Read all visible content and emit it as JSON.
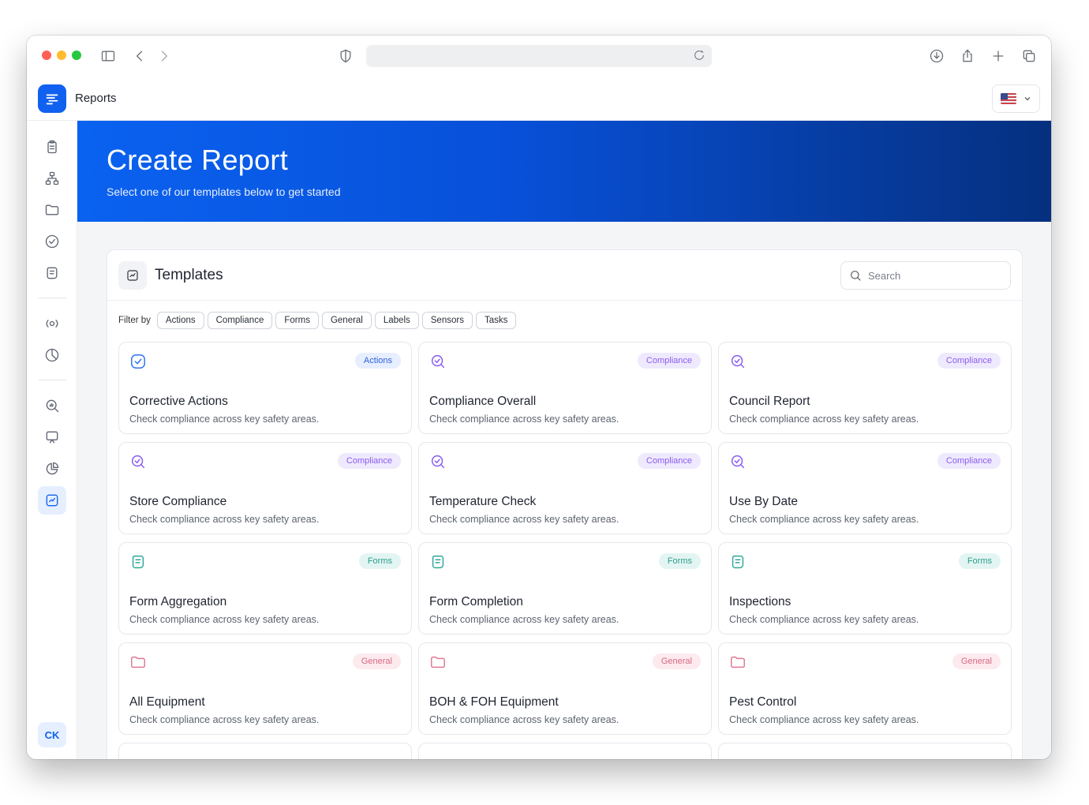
{
  "app": {
    "title": "Reports"
  },
  "hero": {
    "title": "Create Report",
    "subtitle": "Select one of our templates below to get started"
  },
  "templates": {
    "heading": "Templates",
    "search_placeholder": "Search",
    "filter_label": "Filter by",
    "filters": [
      "Actions",
      "Compliance",
      "Forms",
      "General",
      "Labels",
      "Sensors",
      "Tasks"
    ],
    "cards": [
      {
        "title": "Corrective Actions",
        "desc": "Check compliance across key safety areas.",
        "tag": "Actions",
        "icon": "check-circle-icon"
      },
      {
        "title": "Compliance Overall",
        "desc": "Check compliance across key safety areas.",
        "tag": "Compliance",
        "icon": "search-check-icon"
      },
      {
        "title": "Council Report",
        "desc": "Check compliance across key safety areas.",
        "tag": "Compliance",
        "icon": "search-check-icon"
      },
      {
        "title": "Store Compliance",
        "desc": "Check compliance across key safety areas.",
        "tag": "Compliance",
        "icon": "search-check-icon"
      },
      {
        "title": "Temperature Check",
        "desc": "Check compliance across key safety areas.",
        "tag": "Compliance",
        "icon": "search-check-icon"
      },
      {
        "title": "Use By Date",
        "desc": "Check compliance across key safety areas.",
        "tag": "Compliance",
        "icon": "search-check-icon"
      },
      {
        "title": "Form Aggregation",
        "desc": "Check compliance across key safety areas.",
        "tag": "Forms",
        "icon": "forms-icon"
      },
      {
        "title": "Form Completion",
        "desc": "Check compliance across key safety areas.",
        "tag": "Forms",
        "icon": "forms-icon"
      },
      {
        "title": "Inspections",
        "desc": "Check compliance across key safety areas.",
        "tag": "Forms",
        "icon": "forms-icon"
      },
      {
        "title": "All Equipment",
        "desc": "Check compliance across key safety areas.",
        "tag": "General",
        "icon": "folder-icon"
      },
      {
        "title": "BOH & FOH Equipment",
        "desc": "Check compliance across key safety areas.",
        "tag": "General",
        "icon": "folder-icon"
      },
      {
        "title": "Pest Control",
        "desc": "Check compliance across key safety areas.",
        "tag": "General",
        "icon": "folder-icon"
      }
    ]
  },
  "user": {
    "initials": "CK"
  },
  "colors": {
    "brand": "#1061ef",
    "actions": "#2f74f0",
    "compliance": "#8a5cf0",
    "forms": "#2fa79a",
    "general": "#e07a92"
  }
}
